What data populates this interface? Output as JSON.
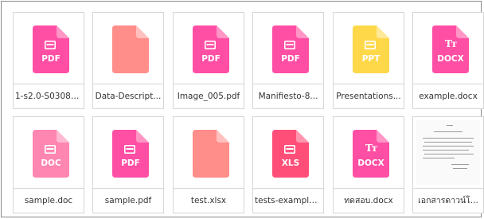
{
  "files": [
    {
      "name": "1-s2.0-S03088...",
      "kind": "pdf",
      "label": "PDF",
      "color": "#ff4fa4",
      "fold": "#ff96c6"
    },
    {
      "name": "Data-Descript...",
      "kind": "blank",
      "label": "",
      "color": "#ff8d8a",
      "fold": "#ffc1bf"
    },
    {
      "name": "Image_005.pdf",
      "kind": "pdf",
      "label": "PDF",
      "color": "#ff4fa4",
      "fold": "#ff96c6"
    },
    {
      "name": "Manifiesto-8...",
      "kind": "pdf",
      "label": "PDF",
      "color": "#ff4fa4",
      "fold": "#ff96c6"
    },
    {
      "name": "Presentations...",
      "kind": "ppt",
      "label": "PPT",
      "color": "#ffd84a",
      "fold": "#ffe998"
    },
    {
      "name": "example.docx",
      "kind": "docx",
      "label": "DOCX",
      "color": "#ff4fa4",
      "fold": "#ff96c6"
    },
    {
      "name": "sample.doc",
      "kind": "doc",
      "label": "DOC",
      "color": "#ff86b0",
      "fold": "#ffb9d2"
    },
    {
      "name": "sample.pdf",
      "kind": "pdf",
      "label": "PDF",
      "color": "#ff4fa4",
      "fold": "#ff96c6"
    },
    {
      "name": "test.xlsx",
      "kind": "blank",
      "label": "",
      "color": "#ff8d8a",
      "fold": "#ffc1bf"
    },
    {
      "name": "tests-example...",
      "kind": "xls",
      "label": "XLS",
      "color": "#ff4f79",
      "fold": "#ff96b0"
    },
    {
      "name": "ทดสอบ.docx",
      "kind": "docx",
      "label": "DOCX",
      "color": "#ff4fa4",
      "fold": "#ff96c6"
    },
    {
      "name": "เอกสารดาวน์โ...",
      "kind": "scan",
      "label": "",
      "color": "",
      "fold": ""
    }
  ]
}
